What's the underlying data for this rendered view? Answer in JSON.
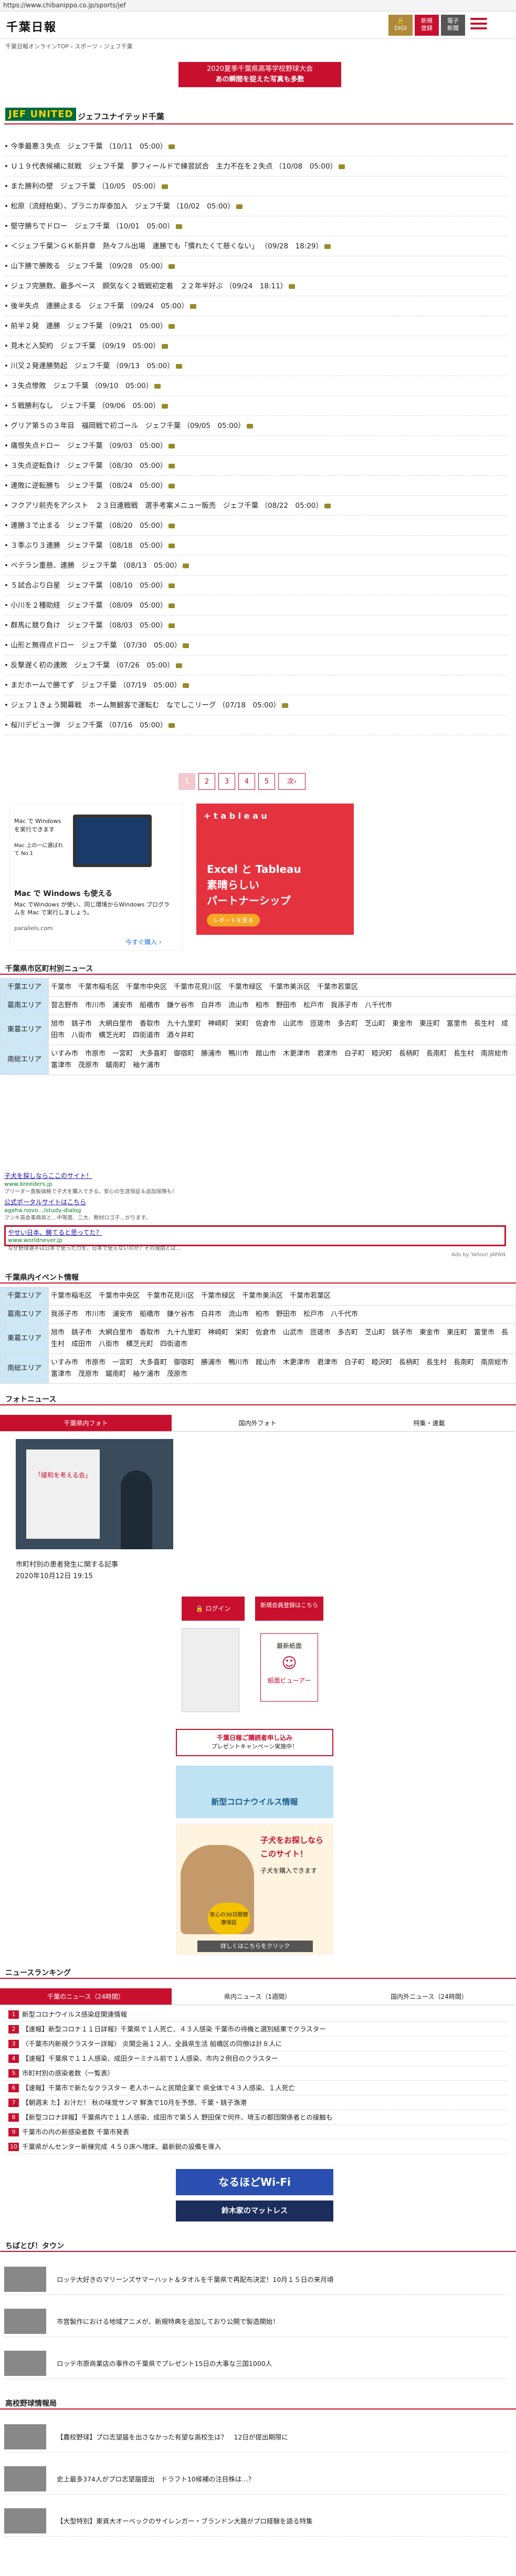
{
  "browser": {
    "url": "https://www.chibanippo.co.jp/sports/jef"
  },
  "header": {
    "logo": "千葉日報",
    "btn_digital": "DIGI",
    "btn_new_l1": "新規",
    "btn_new_l2": "登録",
    "btn_e_l1": "電子",
    "btn_e_l2": "新聞"
  },
  "breadcrumb": "千葉日報オンラインTOP › スポーツ › ジェフ千葉",
  "banner": {
    "line1": "2020夏季千葉県高等学校野球大会",
    "line2": "あの瞬間を捉えた写真も多数"
  },
  "team": {
    "logo": "JEF UNITED",
    "name": "ジェフユナイテッド千葉"
  },
  "news": [
    "今季最悪３失点　ジェフ千葉 （10/11　05:00）",
    "Ｕ１９代表候補に就戦　ジェフ千葉　夢フィールドで練習試合　主力不在を２失点 （10/08　05:00）",
    "また勝利の壁　ジェフ千葉 （10/05　05:00）",
    "松原（流経柏東）、ブラニカ岸泰加入　ジェフ千葉 （10/02　05:00）",
    "堅守勝ちでドロー　ジェフ千葉 （10/01　05:00）",
    "＜ジェフ千葉＞ＧＫ新井章　熱々フル出場　連勝でも「慣れたくて懸くない」 （09/28　18:29）",
    "山下勝で勝敗る　ジェフ千葉 （09/28　05:00）",
    "ジェフ完勝数、最多ペース　鋼気なく２戦戦初定着　２２年半好ぶ （09/24　18:11）",
    "後半失点　連勝止まる　ジェフ千葉 （09/24　05:00）",
    "前半２発　連勝　ジェフ千葉 （09/21　05:00）",
    "見木と入契約　ジェフ千葉 （09/19　05:00）",
    "川又２発連勝勢起　ジェフ千葉 （09/13　05:00）",
    "３失点惨敗　ジェフ千葉 （09/10　05:00）",
    "５戦勝利なし　ジェフ千葉 （09/06　05:00）",
    "グリア第５の３年目　福岡戦で初ゴール　ジェフ千葉 （09/05　05:00）",
    "痛恨失点ドロー　ジェフ千葉 （09/03　05:00）",
    "３失点逆転負け　ジェフ千葉 （08/30　05:00）",
    "連敗に逆転勝ち　ジェフ千葉 （08/24　05:00）",
    "フクアリ前売をアシスト　２３日連戦戦　選手考案メニュー販売　ジェフ千葉 （08/22　05:00）",
    "連勝３で止まる　ジェフ千葉 （08/20　05:00）",
    "３季ぶり３連勝　ジェフ千葉 （08/18　05:00）",
    "ベテラン重懸、連勝　ジェフ千葉 （08/13　05:00）",
    "５試合ぶり白星　ジェフ千葉 （08/10　05:00）",
    "小川を２種助経　ジェフ千葉 （08/09　05:00）",
    "群馬に競り負け　ジェフ千葉 （08/03　05:00）",
    "山形と無得点ドロー　ジェフ千葉 （07/30　05:00）",
    "反撃遅く初の連敗　ジェフ千葉 （07/26　05:00）",
    "まだホームで勝てず　ジェフ千葉 （07/19　05:00）",
    "ジェフ１きょう開幕戦　ホーム無観客で運転む　なでしこリーグ （07/18　05:00）",
    "桜川デビュー弾　ジェフ千葉 （07/16　05:00）"
  ],
  "pager": [
    "1",
    "2",
    "3",
    "4",
    "5",
    "次›"
  ],
  "ad_mac": {
    "t1": "Mac で Windows を実行できます",
    "t2": "Mac 上の一に選ばれて No.1",
    "title": "Mac で Windows も使える",
    "desc": "Mac でWindows が使い、同じ環境からWindows プログラムを Mac で実行しましょう。",
    "domain": "parallels.com",
    "cta": "今すぐ購入 ›"
  },
  "ad_tableau": {
    "brand": "+ t a b l e a u",
    "l1": "Excel と Tableau",
    "l2": "素晴らしい",
    "l3": "パートナーシップ",
    "btn": "レポートを見る"
  },
  "local": {
    "title": "千葉県市区町村別ニュース",
    "rows": [
      {
        "h": "千葉エリア",
        "v": "千葉市　千葉市稲毛区　千葉市中央区　千葉市花見川区　千葉市緑区　千葉市美浜区　千葉市若葉区"
      },
      {
        "h": "葛南エリア",
        "v": "習志野市　市川市　浦安市　船橋市　鎌ケ谷市　白井市　流山市　柏市　野田市　松戸市　我孫子市　八千代市"
      },
      {
        "h": "東葛エリア",
        "v": "旭市　銚子市　大網白里市　香取市　九十九里町　神崎町　栄町　佐倉市　山武市　匝瑳市　多古町　芝山町　東金市　東庄町　富里市　長生村　成田市　八街市　横芝光町　四街道市　酒々井町"
      },
      {
        "h": "南総エリア",
        "v": "いすみ市　市原市　一宮町　大多喜町　御宿町　勝浦市　鴨川市　館山市　木更津市　君津市　白子町　睦沢町　長柄町　長南町　長生村　南房総市　富津市　茂原市　鋸南町　袖ケ浦市"
      }
    ]
  },
  "adlinks": [
    {
      "t": "子犬を探しならここのサイト！",
      "u": "www.breeders.jp",
      "d": "ブリーダー直販価格で子犬を購入できる。安心の生涯保証＆追加保険も！"
    },
    {
      "t": "公式ポータルサイトはこちら",
      "u": "ageha.novo.../study-dialog",
      "d": "フンキ高会事務局と…中等度、二大、教材ロゴ子…がります。"
    },
    {
      "t": "やせい日本、勝てると思ってた？",
      "u": "www.worldnever.jp",
      "d": "なぜ野球選手は日本で使った力を、日本で使えないのか？その理由とは…"
    }
  ],
  "adby": "Ads by Yahoo! JAPAN",
  "events": {
    "title": "千葉県内イベント情報",
    "rows": [
      {
        "h": "千葉エリア",
        "v": "千葉市稲毛区　千葉市中央区　千葉市花見川区　千葉市緑区　千葉市美浜区　千葉市若葉区"
      },
      {
        "h": "葛南エリア",
        "v": "我孫子市　市川市　浦安市　船橋市　鎌ケ谷市　白井市　流山市　柏市　野田市　松戸市　八千代市"
      },
      {
        "h": "東葛エリア",
        "v": "旭市　銚子市　大網白里市　香取市　九十九里町　神崎町　栄町　佐倉市　山武市　匝瑳市　多古町　芝山町　銚子市　東金市　東庄町　富里市　長生村　成田市　八街市　横芝光町　四街道市"
      },
      {
        "h": "南総エリア",
        "v": "いすみ市　市原市　一宮町　大多喜町　御宿町　勝浦市　鴨川市　館山市　木更津市　君津市　白子町　睦沢町　長柄町　長生村　長南町　南房総市　富津市　茂原市　鋸南町　袖ケ浦市　茂原市"
      }
    ]
  },
  "photo": {
    "title": "フォトニュース",
    "tabs": [
      "千葉県内フォト",
      "国内外フォト",
      "特集・連載"
    ],
    "caption": "市町村別の患者発生に関する記事",
    "date": "2020年10月12日 19:15",
    "panel": "「緩和を考える会」"
  },
  "side": {
    "login": "ログイン",
    "register": "新規会員登録はこちら",
    "viewer": "紙面ビューアー",
    "viewer_top": "最新紙面",
    "present": "千葉日報ご購読者申し込み",
    "present_sub": "プレゼントキャンペーン実施中！",
    "corona": "新型コロナウイルス情報",
    "dog_l1": "子犬をお探しなら",
    "dog_l2": "このサイト！",
    "dog_l3": "子犬を購入できます",
    "dog_badge": "安心の30日間健康保証",
    "dog_btn": "詳しくはこちらをクリック"
  },
  "ranking": {
    "title": "ニュースランキング",
    "tabs": [
      "千葉のニュース（24時間）",
      "県内ニュース（1週間）",
      "国内外ニュース（24時間）"
    ],
    "items": [
      "新型コロナウイルス感染症関連情報",
      "【速報】新型コロナ１１日詳報》千葉県で１人死亡、４３人感染 千葉市の待機と選別結果でクラスター",
      "〈千葉市内新規クラスター詳報〉 炎関企画１２人、全員県生活 船橋区の同僚は計８人に",
      "【速報】千葉県で１１人感染、成田ターミナル前で１人感染、市内２例目のクラスター",
      "市町村別の感染者数（一覧表）",
      "【速報】千葉市で新たなクラスター 老人ホームと民間企業で 県全体で４３人感染、１人死亡",
      "【朝週末 た】お汁だ！ 秋の味覚サンマ 鮮漁で10月を予想、千葉・銚子漁港",
      "【新型コロナ詳報】千葉県内で１１人感染、成田市で第５人 野田保で何件、埼玉の都団関係者との接触も",
      "千葉市の内の新感染者数 千葉市発表",
      "千葉県がんセンター新棟完成 ４５０床へ増床、最新鋭の設備を導入"
    ]
  },
  "ban_wifi": "なるほどWi-Fi",
  "ban_suzuki": "鈴木家のマットレス",
  "chiba": {
    "title": "ちばとび！タウン",
    "items": [
      "ロッテ大好きのマリーンズサマーハット＆タオルを千葉県で再配布決定！10月１５日の来月頃",
      "市営製作における地域アニメが、新規特典を追加しており公開で製造開始！",
      "ロッテ市原商業店の事件の千葉県でプレゼント15日の大事な三国1000人"
    ]
  },
  "hs": {
    "title": "高校野球情報局",
    "items": [
      "【農校野球】プロ志望届を出さなかった有望な高校生は？　12日が提出期限に",
      "史上最多374人がプロ志望届提出　ドラフト10候補の注目株は…？",
      "【大型特別】東資大オーベックのサイレンガー・ブランドン大路がプロ経験を語る特集"
    ]
  }
}
